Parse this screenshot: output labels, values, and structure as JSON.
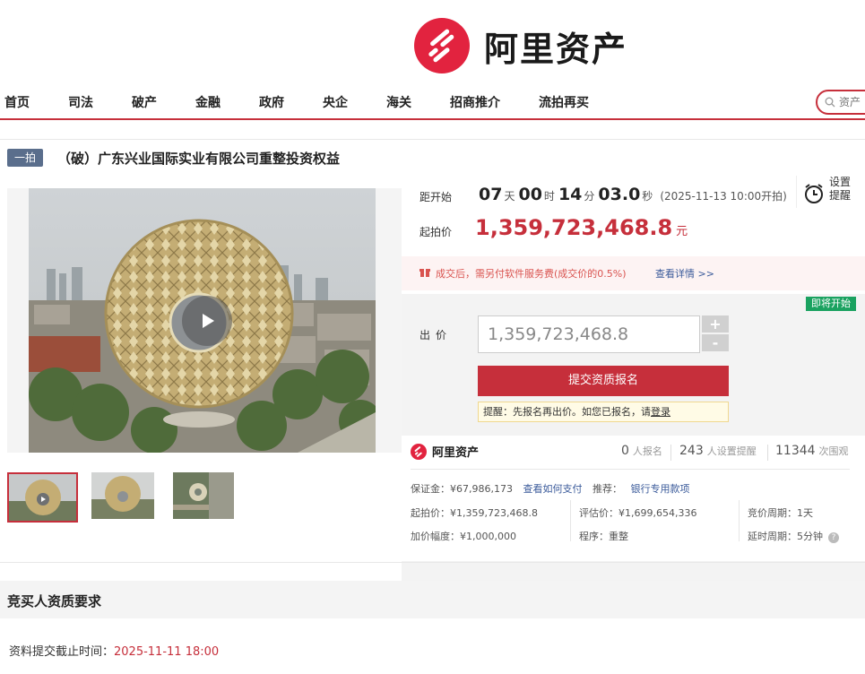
{
  "brand": {
    "name": "阿里资产",
    "color": "#e2233f"
  },
  "nav": {
    "items": [
      "首页",
      "司法",
      "破产",
      "金融",
      "政府",
      "央企",
      "海关",
      "招商推介",
      "流拍再买"
    ],
    "search_placeholder": "资产"
  },
  "item": {
    "tag": "一拍",
    "title": "（破）广东兴业国际实业有限公司重整投资权益"
  },
  "auction": {
    "start_label": "距开始",
    "countdown": {
      "days": "07",
      "days_unit": "天",
      "hours": "00",
      "hours_unit": "时",
      "minutes": "14",
      "minutes_unit": "分",
      "seconds": "03.0",
      "seconds_unit": "秒"
    },
    "start_time": "(2025-11-13 10:00开拍)",
    "reminder": [
      "设置",
      "提醒"
    ],
    "start_price_label": "起拍价",
    "start_price": "1,359,723,468.8",
    "price_unit": "元",
    "notice": "成交后，需另付软件服务费(成交价的0.5%)",
    "notice_link": "查看详情 >>",
    "badge": "即将开始",
    "bid_label": "出价",
    "bid_value": "1,359,723,468.8",
    "plus": "+",
    "minus": "-",
    "submit": "提交资质报名",
    "tip_text": "提醒：先报名再出价。如您已报名，请",
    "tip_link": "登录"
  },
  "stats": {
    "brand": "阿里资产",
    "signed_count": "0",
    "signed_label": "人报名",
    "remind_count": "243",
    "remind_label": "人设置提醒",
    "views_count": "11344",
    "views_label": "次围观"
  },
  "info": {
    "deposit": "保证金：¥67,986,173",
    "deposit_link": "查看如何支付",
    "recommend_label": "推荐：",
    "recommend_link": "银行专用款项",
    "start_price": "起拍价：¥1,359,723,468.8",
    "eval_price": "评估价：¥1,699,654,336",
    "cycle": "竞价周期：1天",
    "increment": "加价幅度：¥1,000,000",
    "procedure": "程序：重整",
    "delay": "延时周期：5分钟",
    "delay_help": "?"
  },
  "section": {
    "title": "竞买人资质要求",
    "deadline_label": "资料提交截止时间：",
    "deadline_value": "2025-11-11 18:00"
  }
}
